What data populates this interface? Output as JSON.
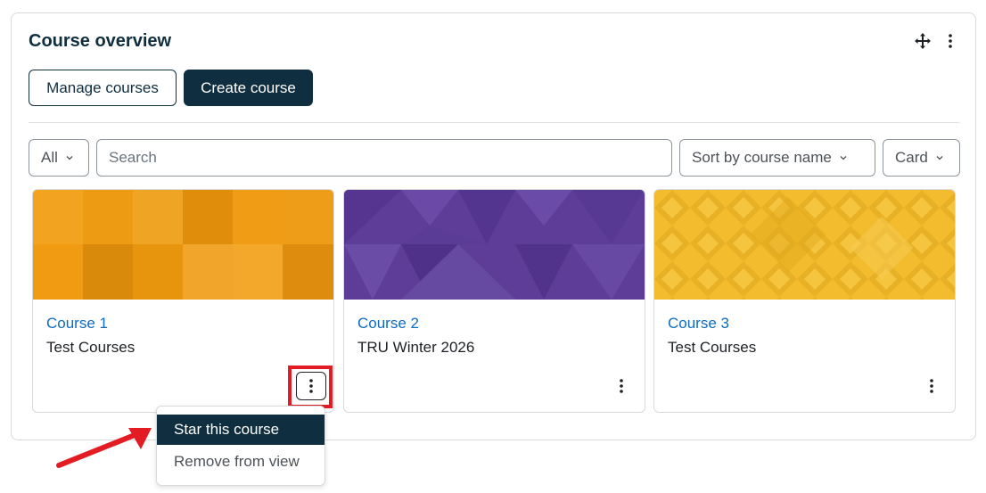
{
  "block": {
    "title": "Course overview"
  },
  "buttons": {
    "manage": "Manage courses",
    "create": "Create course"
  },
  "filters": {
    "grouping": "All",
    "search_placeholder": "Search",
    "sort": "Sort by course name",
    "view": "Card"
  },
  "courses": [
    {
      "name": "Course 1",
      "category": "Test Courses",
      "image_color": "#f0a018"
    },
    {
      "name": "Course 2",
      "category": "TRU Winter 2026",
      "image_color": "#5e3d99"
    },
    {
      "name": "Course 3",
      "category": "Test Courses",
      "image_color": "#f2bc2e"
    }
  ],
  "menu": {
    "star": "Star this course",
    "remove": "Remove from view"
  },
  "colors": {
    "primary": "#0f2e3f",
    "link": "#0f6cbf",
    "highlight": "#e31b23"
  },
  "icons": {
    "move": "move-icon",
    "more": "kebab-icon",
    "chevron": "chevron-down-icon"
  }
}
